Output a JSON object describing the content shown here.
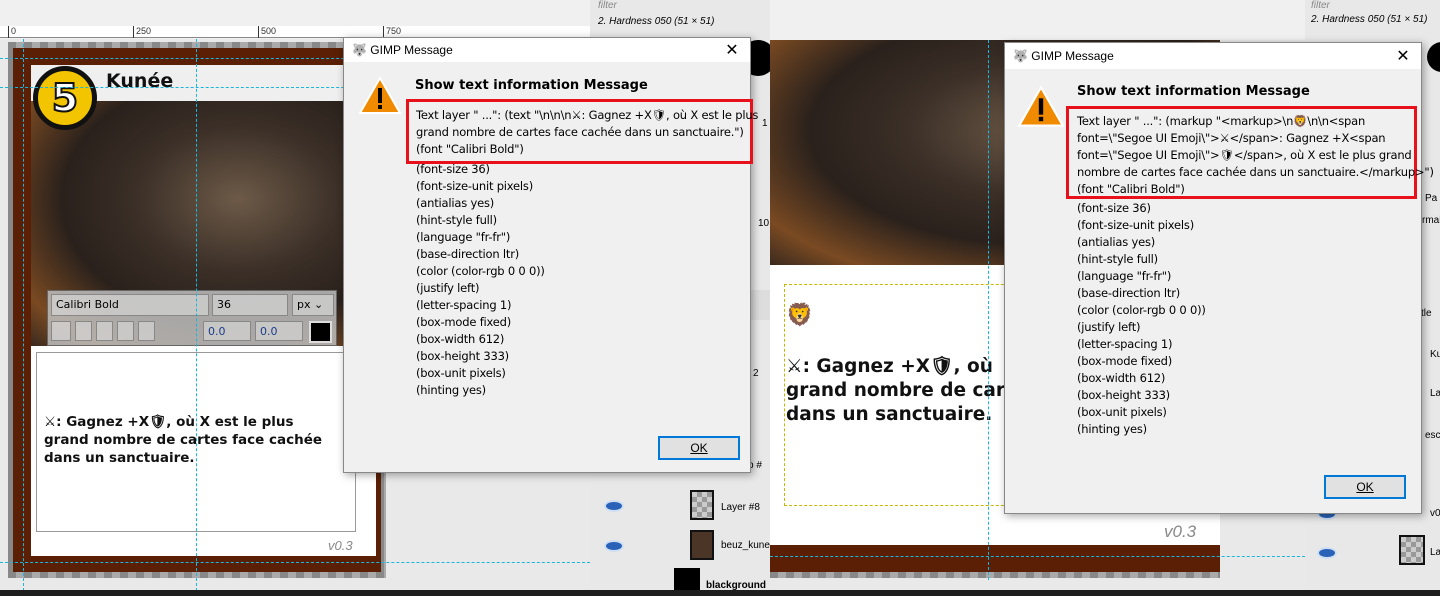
{
  "left": {
    "ruler_ticks": [
      "0",
      "250",
      "500",
      "750"
    ],
    "card": {
      "cost": "5",
      "name": "Kunée",
      "text_line1": "⚔: Gagnez +X🛡, où X est le plus",
      "text_line2": "grand nombre de cartes face cachée",
      "text_line3": "dans un sanctuaire.",
      "version": "v0.3"
    },
    "text_toolbar": {
      "font": "Calibri Bold",
      "size": "36",
      "unit": "px",
      "baseline": "0.0",
      "kerning": "0.0"
    },
    "dock": {
      "filter_placeholder": "filter",
      "brush": "2. Hardness 050 (51 × 51)",
      "val1": "1",
      "val2": "10",
      "partial1": "2",
      "partial2": "p #",
      "layers": [
        "Layer #8",
        "beuz_kune",
        "blackground"
      ]
    },
    "dialog": {
      "title": "GIMP Message",
      "heading": "Show text information Message",
      "ok": "OK",
      "highlighted": [
        "Text layer \" ...\": (text \"\\n\\n\\n⚔: Gagnez +X🛡, où X est le plus",
        "grand nombre de cartes face cachée dans un sanctuaire.\")",
        "(font \"Calibri Bold\")"
      ],
      "lines": [
        "(font-size 36)",
        "(font-size-unit pixels)",
        "(antialias yes)",
        "(hint-style full)",
        "(language \"fr-fr\")",
        "(base-direction ltr)",
        "(color (color-rgb 0 0 0))",
        "(justify left)",
        "(letter-spacing 1)",
        "(box-mode fixed)",
        "(box-width 612)",
        "(box-height 333)",
        "(box-unit pixels)",
        "(hinting yes)"
      ]
    }
  },
  "right": {
    "card": {
      "lion": "🦁",
      "text_line1": "⚔: Gagnez +X🛡, où",
      "text_line2": "grand nombre de car",
      "text_line3": "dans un sanctuaire.",
      "version": "v0.3"
    },
    "dock": {
      "filter_placeholder": "filter",
      "brush": "2. Hardness 050 (51 × 51)",
      "partials": [
        "Pa",
        "rmal",
        "tle",
        "Ku",
        "La",
        "esc",
        "v0",
        "La"
      ]
    },
    "dialog": {
      "title": "GIMP Message",
      "heading": "Show text information Message",
      "ok": "OK",
      "highlighted": [
        "Text layer \" ...\": (markup \"<markup>\\n🦁\\n\\n<span",
        "font=\\\"Segoe UI Emoji\\\">⚔</span>: Gagnez +X<span",
        "font=\\\"Segoe UI Emoji\\\">🛡</span>, où X est le plus grand",
        "nombre de cartes face cachée dans un sanctuaire.</markup>\")",
        "(font \"Calibri Bold\")"
      ],
      "lines": [
        "(font-size 36)",
        "(font-size-unit pixels)",
        "(antialias yes)",
        "(hint-style full)",
        "(language \"fr-fr\")",
        "(base-direction ltr)",
        "(color (color-rgb 0 0 0))",
        "(justify left)",
        "(letter-spacing 1)",
        "(box-mode fixed)",
        "(box-width 612)",
        "(box-height 333)",
        "(box-unit pixels)",
        "(hinting yes)"
      ]
    }
  },
  "colors": {
    "highlight": "#e8101a",
    "frame": "#5a1f05",
    "guide": "#19b6e0",
    "cost_badge": "#f2c500"
  }
}
